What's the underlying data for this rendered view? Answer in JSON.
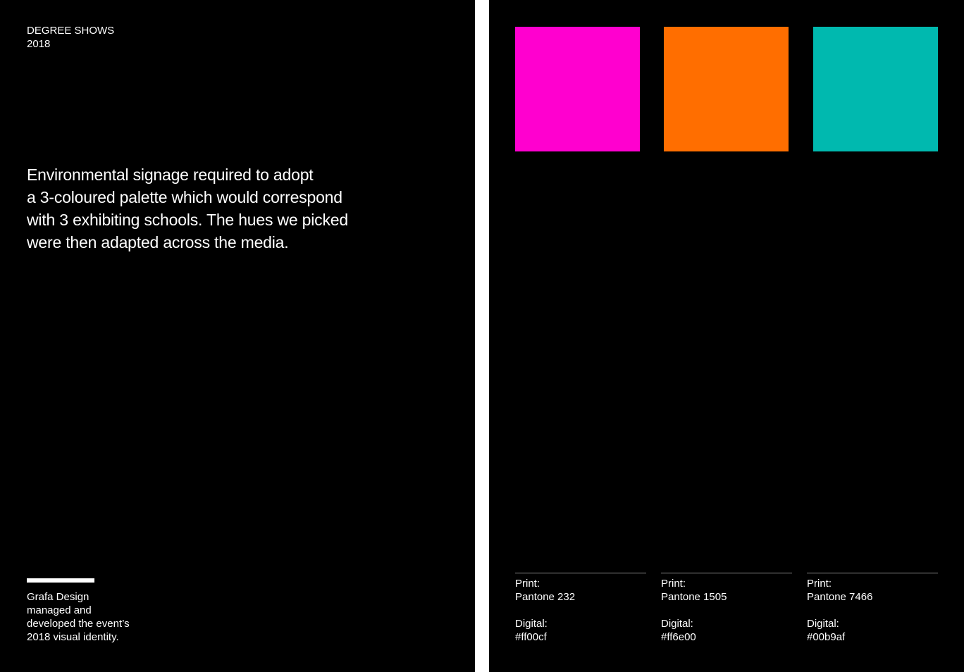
{
  "left_page": {
    "header": {
      "line1": "DEGREE SHOWS",
      "line2": "2018"
    },
    "lead": {
      "line1": "Environmental signage required to adopt",
      "line2": "a 3-coloured palette which would correspond",
      "line3": "with 3 exhibiting schools. The hues we picked",
      "line4": "were then adapted across the media."
    },
    "credit": {
      "line1": "Grafa Design",
      "line2": "managed and",
      "line3": "developed the event’s",
      "line4": "2018 visual identity."
    }
  },
  "right_page": {
    "swatches": [
      {
        "color": "#ff00cf",
        "print_label": "Print:",
        "print_value": "Pantone 232",
        "digital_label": "Digital:",
        "digital_value": "#ff00cf"
      },
      {
        "color": "#ff6e00",
        "print_label": "Print:",
        "print_value": "Pantone 1505",
        "digital_label": "Digital:",
        "digital_value": "#ff6e00"
      },
      {
        "color": "#00b9af",
        "print_label": "Print:",
        "print_value": "Pantone 7466",
        "digital_label": "Digital:",
        "digital_value": "#00b9af"
      }
    ]
  },
  "colors": {
    "page_background": "#000000",
    "text": "#ffffff",
    "gutter": "#ffffff"
  }
}
